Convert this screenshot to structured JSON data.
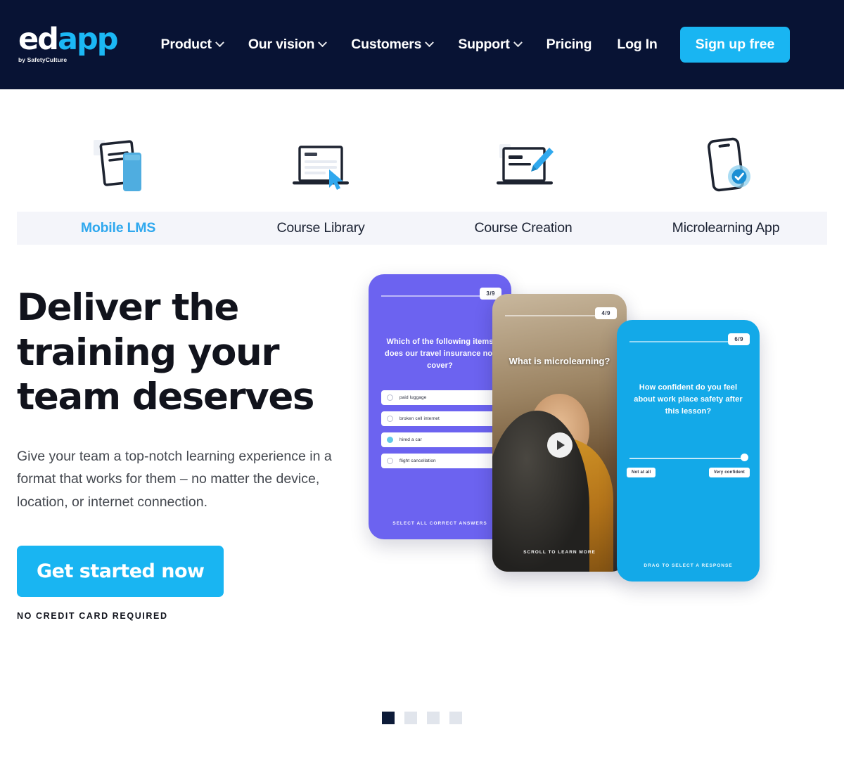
{
  "header": {
    "logo": {
      "primary": "ed",
      "accent": "app",
      "tagline": "by SafetyCulture"
    },
    "nav": [
      {
        "label": "Product",
        "has_dropdown": true
      },
      {
        "label": "Our vision",
        "has_dropdown": true
      },
      {
        "label": "Customers",
        "has_dropdown": true
      },
      {
        "label": "Support",
        "has_dropdown": true
      },
      {
        "label": "Pricing",
        "has_dropdown": false
      },
      {
        "label": "Log In",
        "has_dropdown": false
      }
    ],
    "cta_label": "Sign up free",
    "background_color": "#081334",
    "accent_color": "#19B5F2"
  },
  "tabs": {
    "active_index": 0,
    "items": [
      {
        "label": "Mobile LMS",
        "icon": "document-phone-icon"
      },
      {
        "label": "Course Library",
        "icon": "laptop-cursor-icon"
      },
      {
        "label": "Course Creation",
        "icon": "laptop-pen-icon"
      },
      {
        "label": "Microlearning App",
        "icon": "phone-check-icon"
      }
    ]
  },
  "hero": {
    "title_lines": [
      "Deliver the",
      "training your",
      "team deserves"
    ],
    "subtitle": "Give your team a top-notch learning experience in a format that works for them – no matter the device, location, or internet connection.",
    "cta_label": "Get started now",
    "cta_note": "NO CREDIT CARD REQUIRED"
  },
  "mockups": {
    "quiz_card": {
      "counter": "3/9",
      "question": "Which of the following items does our travel insurance not cover?",
      "options": [
        {
          "text": "paid luggage",
          "selected": false
        },
        {
          "text": "broken cell internet",
          "selected": false
        },
        {
          "text": "hired a car",
          "selected": true
        },
        {
          "text": "flight cancellation",
          "selected": false
        }
      ],
      "footer": "SELECT ALL CORRECT ANSWERS",
      "background_color": "#6C63F0"
    },
    "video_card": {
      "counter": "4/9",
      "title": "What is microlearning?",
      "caption": "SCROLL TO LEARN MORE",
      "play_icon": "play-icon"
    },
    "survey_card": {
      "counter": "6/9",
      "question": "How confident do you feel about work place safety after this lesson?",
      "slider_min_label": "Not at all",
      "slider_max_label": "Very confident",
      "footer": "DRAG TO SELECT A RESPONSE",
      "background_color": "#13A9E8"
    }
  },
  "carousel": {
    "total": 4,
    "active_index": 0
  }
}
